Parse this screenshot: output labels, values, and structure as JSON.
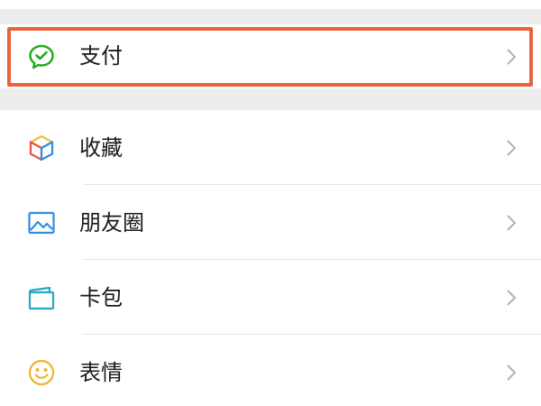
{
  "menu": {
    "items": [
      {
        "label": "支付",
        "icon": "wechat-pay-icon",
        "highlighted": true
      },
      {
        "label": "收藏",
        "icon": "favorites-cube-icon"
      },
      {
        "label": "朋友圈",
        "icon": "moments-picture-icon"
      },
      {
        "label": "卡包",
        "icon": "card-wallet-icon"
      },
      {
        "label": "表情",
        "icon": "smiley-icon"
      }
    ]
  },
  "colors": {
    "highlight_border": "#e8643b",
    "pay_green": "#1aad19",
    "chevron": "#b2b2b2",
    "background": "#ededed"
  }
}
